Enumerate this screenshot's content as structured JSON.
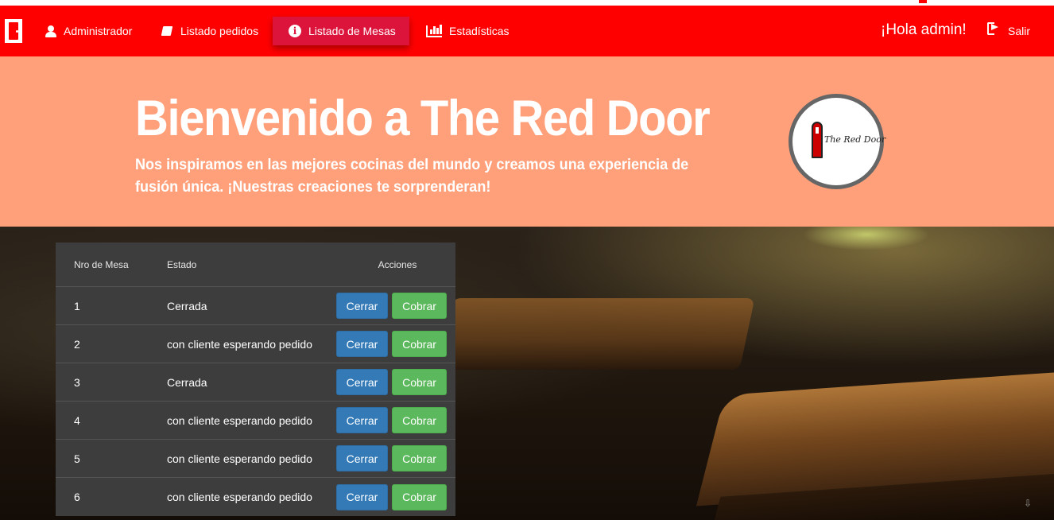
{
  "nav": {
    "items": [
      {
        "label": "Administrador",
        "icon": "user-icon"
      },
      {
        "label": "Listado pedidos",
        "icon": "book-icon"
      },
      {
        "label": "Listado de Mesas",
        "icon": "info-circle-icon",
        "active": true
      },
      {
        "label": "Estadísticas",
        "icon": "bar-chart-icon"
      }
    ],
    "greeting": "¡Hola admin!",
    "logout_label": "Salir"
  },
  "hero": {
    "title": "Bienvenido a The Red Door",
    "subtitle": "Nos inspiramos en las mejores cocinas del mundo y creamos una experiencia de fusión única. ¡Nuestras creaciones te sorprenderan!",
    "logo_text": "The Red Door"
  },
  "table": {
    "headers": {
      "number": "Nro de Mesa",
      "status": "Estado",
      "actions": "Acciones"
    },
    "close_label": "Cerrar",
    "charge_label": "Cobrar",
    "rows": [
      {
        "number": "1",
        "status": "Cerrada"
      },
      {
        "number": "2",
        "status": "con cliente esperando pedido"
      },
      {
        "number": "3",
        "status": "Cerrada"
      },
      {
        "number": "4",
        "status": "con cliente esperando pedido"
      },
      {
        "number": "5",
        "status": "con cliente esperando pedido"
      },
      {
        "number": "6",
        "status": "con cliente esperando pedido"
      }
    ]
  },
  "colors": {
    "navbar": "#ff0000",
    "nav_active": "#dc143c",
    "hero_bg": "#ffa07a",
    "table_bg": "#3d3d3d",
    "btn_primary": "#337ab7",
    "btn_success": "#5cb85c"
  }
}
